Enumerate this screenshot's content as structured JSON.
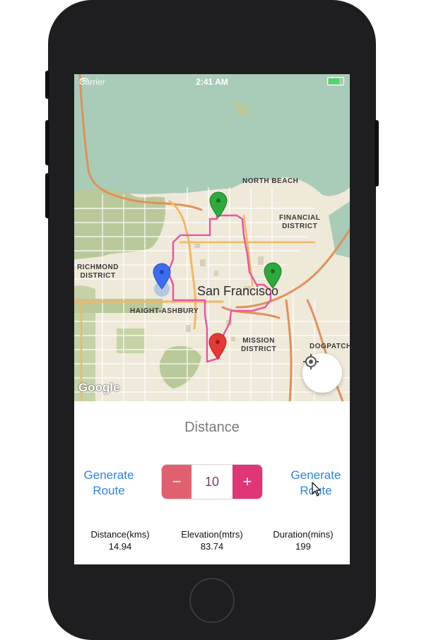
{
  "status_bar": {
    "carrier": "Carrier",
    "time": "2:41 AM"
  },
  "map": {
    "city": "San Francisco",
    "neighborhoods": [
      "NORTH BEACH",
      "FINANCIAL\nDISTRICT",
      "RICHMOND\nDISTRICT",
      "HAIGHT-ASHBURY",
      "MISSION\nDISTRICT",
      "DOGPATCH"
    ],
    "attribution": "Google",
    "colors": {
      "route": "#e8579f",
      "water": "#a9ccb9",
      "park": "#b9c99a",
      "land": "#efe9d9",
      "major_road": "#e0915a",
      "highway": "#f0b864"
    },
    "markers": [
      {
        "name": "waypoint",
        "color": "#2eaa3c",
        "icon": "map-pin-icon"
      },
      {
        "name": "waypoint",
        "color": "#2eaa3c",
        "icon": "map-pin-icon"
      },
      {
        "name": "start",
        "color": "#3a6df0",
        "icon": "map-pin-icon"
      },
      {
        "name": "end",
        "color": "#e53935",
        "icon": "map-pin-icon"
      }
    ],
    "locate_icon": "my-location-icon"
  },
  "panel": {
    "title": "Distance",
    "generate_left": "Generate\nRoute",
    "generate_right": "Generate\nRoute",
    "stepper": {
      "minus": "−",
      "value": "10",
      "plus": "+"
    },
    "stats": [
      {
        "label": "Distance(kms)",
        "value": "14.94"
      },
      {
        "label": "Elevation(mtrs)",
        "value": "83.74"
      },
      {
        "label": "Duration(mins)",
        "value": "199"
      }
    ]
  }
}
